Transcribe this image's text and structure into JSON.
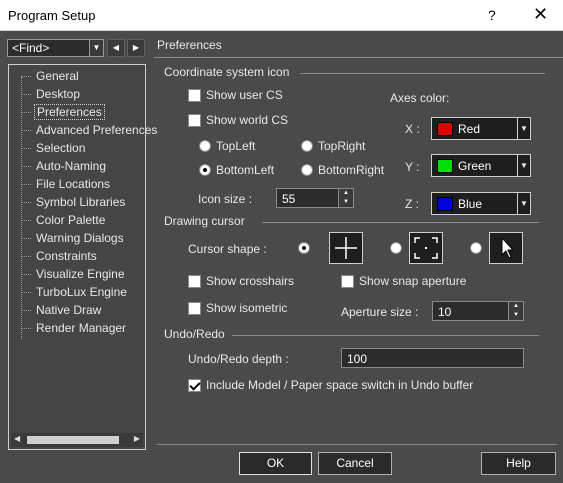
{
  "window": {
    "title": "Program Setup",
    "help_glyph": "?",
    "close_glyph": "✕"
  },
  "nav": {
    "find_value": "<Find>",
    "back_glyph": "◀",
    "forward_glyph": "▶",
    "dropdown_glyph": "▼"
  },
  "tree": {
    "items": [
      "General",
      "Desktop",
      "Preferences",
      "Advanced Preferences",
      "Selection",
      "Auto-Naming",
      "File Locations",
      "Symbol Libraries",
      "Color Palette",
      "Warning Dialogs",
      "Constraints",
      "Visualize Engine",
      "TurboLux Engine",
      "Native Draw",
      "Render Manager"
    ],
    "selected": "Preferences",
    "scroll_left_glyph": "◀",
    "scroll_right_glyph": "▶"
  },
  "pane": {
    "title": "Preferences"
  },
  "coord": {
    "group_label": "Coordinate system icon",
    "show_user_cs": "Show user CS",
    "show_user_cs_checked": false,
    "show_world_cs": "Show world CS",
    "show_world_cs_checked": false,
    "pos_topleft": "TopLeft",
    "pos_topright": "TopRight",
    "pos_bottomleft": "BottomLeft",
    "pos_bottomright": "BottomRight",
    "selected_position": "BottomLeft",
    "icon_size_label": "Icon size :",
    "icon_size_value": "55",
    "axes_color_label": "Axes color:",
    "x_label": "X :",
    "y_label": "Y :",
    "z_label": "Z :",
    "x_color_name": "Red",
    "y_color_name": "Green",
    "z_color_name": "Blue",
    "x_color": "#e00000",
    "y_color": "#00e000",
    "z_color": "#0000e0"
  },
  "cursor": {
    "group_label": "Drawing cursor",
    "shape_label": "Cursor shape :",
    "shapes": [
      "crosshair-icon",
      "aperture-icon",
      "arrow-pointer-icon"
    ],
    "selected_shape": "crosshair",
    "show_crosshairs": "Show crosshairs",
    "show_crosshairs_checked": false,
    "show_snap_aperture": "Show snap aperture",
    "show_snap_aperture_checked": false,
    "show_isometric": "Show isometric",
    "show_isometric_checked": false,
    "aperture_size_label": "Aperture size :",
    "aperture_size_value": "10"
  },
  "undo": {
    "group_label": "Undo/Redo",
    "depth_label": "Undo/Redo depth :",
    "depth_value": "100",
    "include_switch": "Include Model / Paper space switch in Undo buffer",
    "include_switch_checked": true
  },
  "buttons": {
    "ok": "OK",
    "cancel": "Cancel",
    "help": "Help"
  },
  "spin_glyphs": {
    "up": "▲",
    "down": "▼"
  }
}
